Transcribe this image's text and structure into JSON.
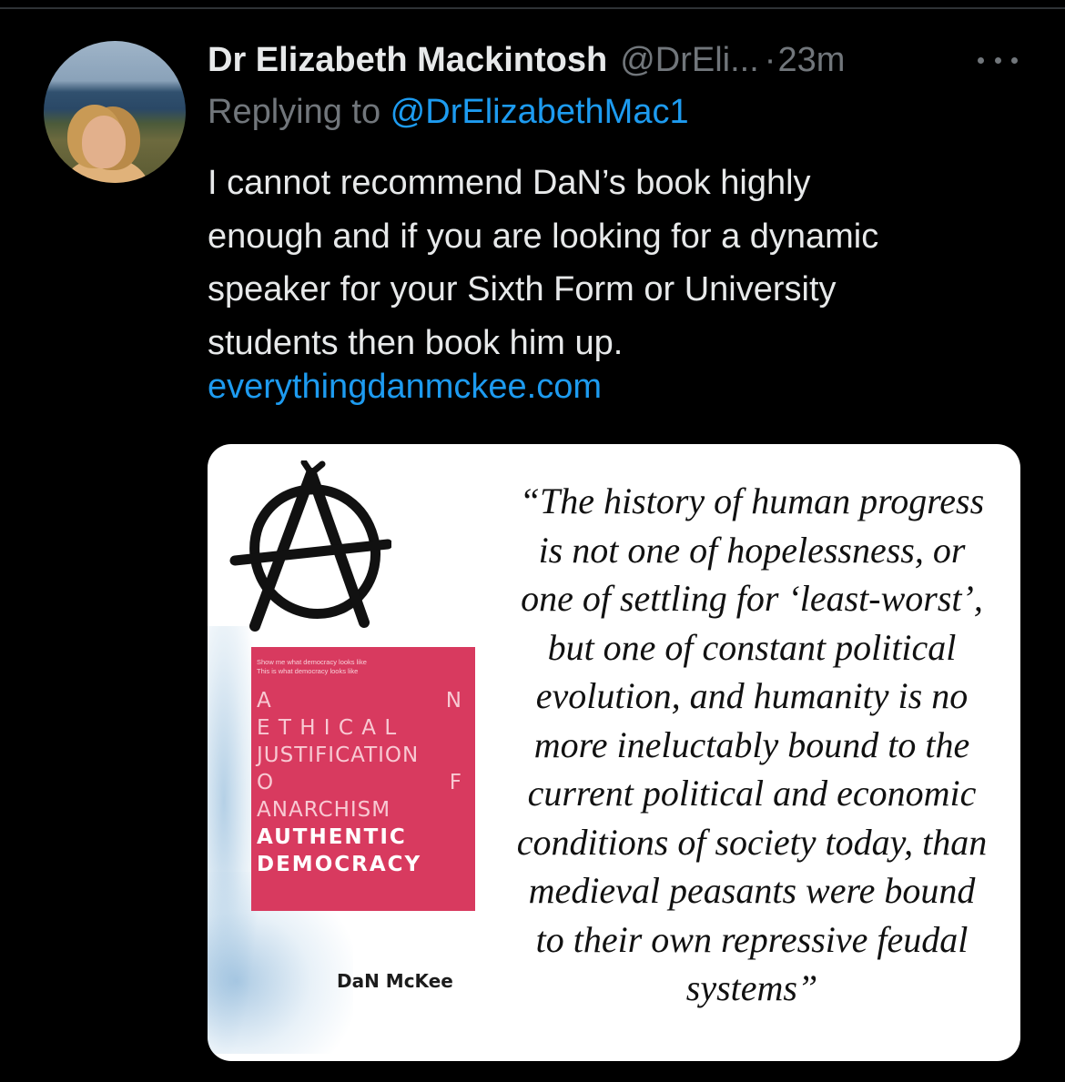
{
  "tweet": {
    "author_name": "Dr Elizabeth Mackintosh",
    "author_handle": "@DrEli...",
    "separator": "·",
    "time": "23m",
    "reply_prefix": "Replying to ",
    "reply_handle": "@DrElizabethMac1",
    "text_lines": [
      "I cannot recommend DaN’s book highly",
      "enough and if you are looking for a dynamic",
      "speaker for your Sixth Form or University",
      "students then book him up."
    ],
    "link": "everythingdanmckee.com",
    "more_icon": "more-horizontal-icon"
  },
  "media": {
    "book": {
      "subtitle": "Show me what democracy looks like\nThis is what democracy looks like",
      "lines": [
        {
          "left": "A",
          "right": "N",
          "style": "thin"
        },
        {
          "left": "E T H I C A L",
          "right": "",
          "style": "thin"
        },
        {
          "left": "JUSTIFICATION",
          "right": "",
          "style": "thin"
        },
        {
          "left": "O",
          "right": "F",
          "style": "thin"
        },
        {
          "left": "ANARCHISM",
          "right": "",
          "style": "thin"
        },
        {
          "left": "AUTHENTIC",
          "right": "",
          "style": "bold"
        },
        {
          "left": "DEMOCRACY",
          "right": "",
          "style": "bold"
        }
      ],
      "author": "DaN McKee"
    },
    "quote_lines": [
      "“The history of human progress",
      "is not one of hopelessness, or",
      "one of settling for ‘least-worst’,",
      "but one of constant political",
      "evolution, and humanity is no",
      "more ineluctably bound to the",
      "current political and economic",
      "conditions of society today, than",
      "medieval peasants were bound",
      "to their own repressive feudal",
      "systems”"
    ]
  },
  "colors": {
    "background": "#000000",
    "primary_text": "#e7e9ea",
    "secondary_text": "#71767b",
    "link": "#1d9bf0",
    "book_cover": "#d83a5f"
  }
}
